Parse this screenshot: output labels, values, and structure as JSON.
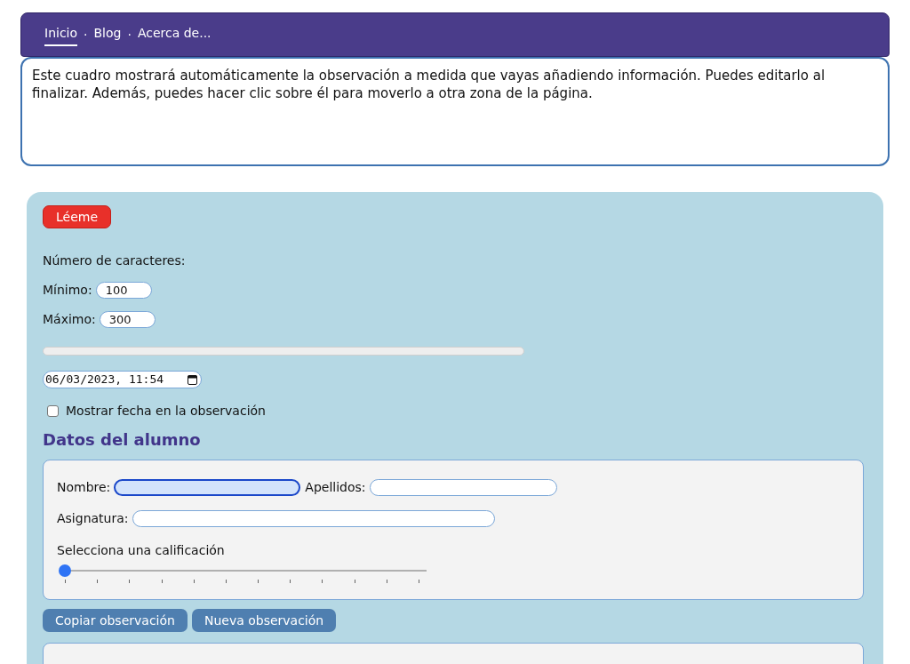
{
  "nav": {
    "items": [
      {
        "label": "Inicio",
        "selected": true
      },
      {
        "label": "Blog",
        "selected": false
      },
      {
        "label": "Acerca de...",
        "selected": false
      }
    ],
    "separator": "·"
  },
  "observation_box": {
    "value": "Este cuadro mostrará automáticamente la observación a medida que vayas añadiendo información. Puedes editarlo al finalizar. Además, puedes hacer clic sobre él para moverlo a otra zona de la página."
  },
  "readme_button": "Léeme",
  "char_count": {
    "heading": "Número de caracteres:",
    "min_label": "Mínimo:",
    "min_value": "100",
    "max_label": "Máximo:",
    "max_value": "300",
    "progress": {
      "level": 0
    }
  },
  "date_field": {
    "value": "06/03/2023, 11:54"
  },
  "show_date": {
    "label": "Mostrar fecha en la observación",
    "checked": false
  },
  "student": {
    "title": "Datos del alumno",
    "fields": [
      {
        "label": "Nombre:",
        "focused": true
      },
      {
        "label": "Apellidos:",
        "focused": false
      },
      {
        "label": "Asignatura:",
        "focused": false
      }
    ],
    "grade": {
      "label": "Selecciona una calificación",
      "level": 0
    }
  },
  "buttons": [
    "Copiar observación",
    "Nueva observación"
  ]
}
